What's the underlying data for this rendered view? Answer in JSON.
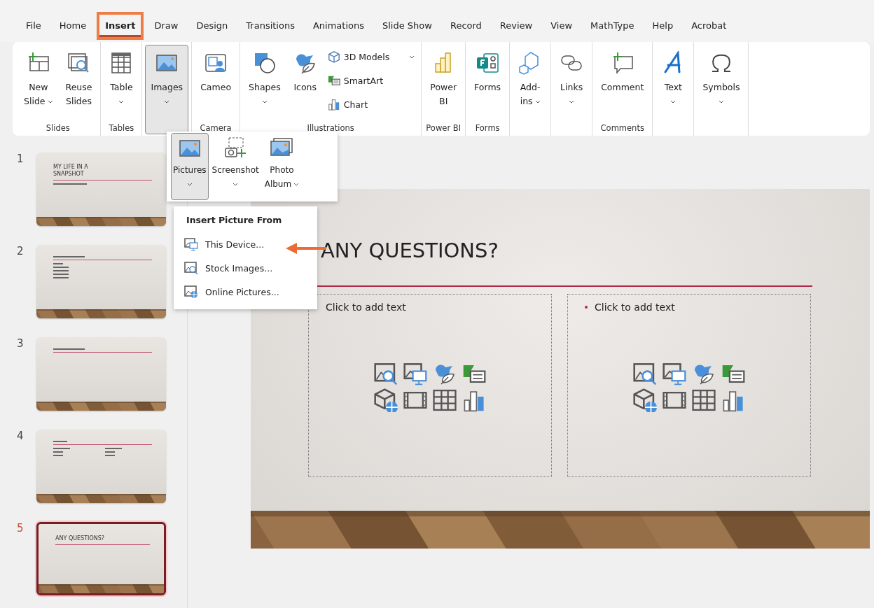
{
  "tabs": [
    {
      "label": "File",
      "selected": false
    },
    {
      "label": "Home",
      "selected": false
    },
    {
      "label": "Insert",
      "selected": true,
      "highlighted": true
    },
    {
      "label": "Draw",
      "selected": false
    },
    {
      "label": "Design",
      "selected": false
    },
    {
      "label": "Transitions",
      "selected": false
    },
    {
      "label": "Animations",
      "selected": false
    },
    {
      "label": "Slide Show",
      "selected": false
    },
    {
      "label": "Record",
      "selected": false
    },
    {
      "label": "Review",
      "selected": false
    },
    {
      "label": "View",
      "selected": false
    },
    {
      "label": "MathType",
      "selected": false
    },
    {
      "label": "Help",
      "selected": false
    },
    {
      "label": "Acrobat",
      "selected": false
    }
  ],
  "ribbon": [
    {
      "label": "Slides",
      "buttons": [
        {
          "kind": "large",
          "label": "New\nSlide",
          "dropdown": true,
          "pressed": false
        },
        {
          "kind": "large",
          "label": "Reuse\nSlides",
          "pressed": false
        }
      ]
    },
    {
      "label": "Tables",
      "buttons": [
        {
          "kind": "large",
          "label": "Table",
          "dropdown": true,
          "pressed": false
        }
      ]
    },
    {
      "buttons": [
        {
          "kind": "large",
          "label": "Images",
          "dropdown": true,
          "pressed": true
        }
      ]
    },
    {
      "label": "Camera",
      "buttons": [
        {
          "kind": "large",
          "label": "Cameo",
          "pressed": false
        }
      ]
    },
    {
      "label": "Illustrations",
      "buttons": [
        {
          "kind": "large",
          "label": "Shapes",
          "dropdown": true,
          "pressed": false
        },
        {
          "kind": "large",
          "label": "Icons",
          "pressed": false
        },
        {
          "kind": "small",
          "label": "3D Models",
          "dropdown": true,
          "pressed": false
        },
        {
          "kind": "small",
          "label": "SmartArt",
          "pressed": false
        },
        {
          "kind": "small",
          "label": "Chart",
          "pressed": false
        }
      ]
    },
    {
      "label": "Power BI",
      "buttons": [
        {
          "kind": "large",
          "label": "Power\nBI",
          "pressed": false
        }
      ]
    },
    {
      "label": "Forms",
      "buttons": [
        {
          "kind": "large",
          "label": "Forms",
          "pressed": false
        }
      ]
    },
    {
      "buttons": [
        {
          "kind": "large",
          "label": "Add-\nins",
          "dropdown": true,
          "pressed": false
        }
      ]
    },
    {
      "buttons": [
        {
          "kind": "large",
          "label": "Links",
          "dropdown": true,
          "pressed": false
        }
      ]
    },
    {
      "label": "Comments",
      "buttons": [
        {
          "kind": "large",
          "label": "Comment",
          "pressed": false
        }
      ]
    },
    {
      "buttons": [
        {
          "kind": "large",
          "label": "Text",
          "dropdown": true,
          "pressed": false
        }
      ]
    },
    {
      "buttons": [
        {
          "kind": "large",
          "label": "Symbols",
          "dropdown": true,
          "pressed": false
        }
      ]
    }
  ],
  "images_gallery": [
    {
      "label": "Pictures",
      "dropdown": true,
      "pressed": true
    },
    {
      "label": "Screenshot",
      "dropdown": true,
      "pressed": false
    },
    {
      "label": "Photo\nAlbum",
      "dropdown": true,
      "pressed": false
    }
  ],
  "picture_menu": {
    "header": "Insert Picture From",
    "items": [
      {
        "label": "This Device..."
      },
      {
        "label": "Stock Images..."
      },
      {
        "label": "Online Pictures..."
      }
    ]
  },
  "slides": [
    {
      "number": "1",
      "selected": false,
      "kind": "title",
      "title": "MY LIFE IN A\nSNAPSHOT"
    },
    {
      "number": "2",
      "selected": false,
      "kind": "bullets"
    },
    {
      "number": "3",
      "selected": false,
      "kind": "title-only"
    },
    {
      "number": "4",
      "selected": false,
      "kind": "two-column"
    },
    {
      "number": "5",
      "selected": true,
      "kind": "title",
      "title": "ANY QUESTIONS?"
    }
  ],
  "current_slide": {
    "title": "ANY QUESTIONS?",
    "placeholders": [
      {
        "prompt": "Click to add text",
        "bullet": false
      },
      {
        "prompt": "Click to add text",
        "bullet": true
      }
    ]
  }
}
